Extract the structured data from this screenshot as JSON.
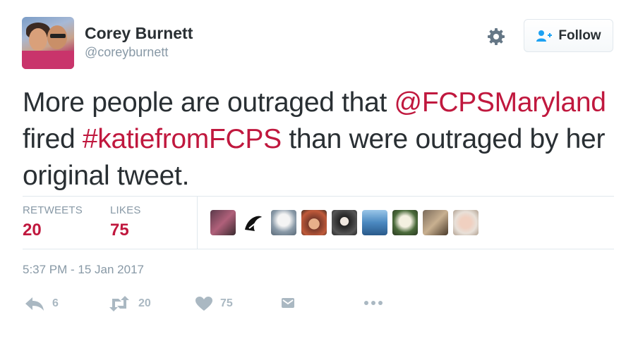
{
  "user": {
    "name": "Corey Burnett",
    "handle": "@coreyburnett"
  },
  "follow_button": {
    "label": "Follow"
  },
  "tweet": {
    "text_1": "More people are outraged that ",
    "mention": "@FCPSMaryland",
    "text_2": " fired ",
    "hashtag": "#katiefromFCPS",
    "text_3": " than were outraged by her original tweet."
  },
  "stats": {
    "retweets_label": "RETWEETS",
    "retweets_value": "20",
    "likes_label": "LIKES",
    "likes_value": "75"
  },
  "timestamp": "5:37 PM - 15 Jan 2017",
  "actions": {
    "reply_count": "6",
    "retweet_count": "20",
    "like_count": "75"
  },
  "colors": {
    "accent": "#c0183e",
    "muted": "#8899a6",
    "icon": "#aab8c2",
    "text": "#292f33"
  },
  "icons": [
    "gear-icon",
    "follow-person-plus-icon",
    "reply-icon",
    "retweet-icon",
    "heart-icon",
    "direct-message-icon",
    "more-dots-icon"
  ]
}
